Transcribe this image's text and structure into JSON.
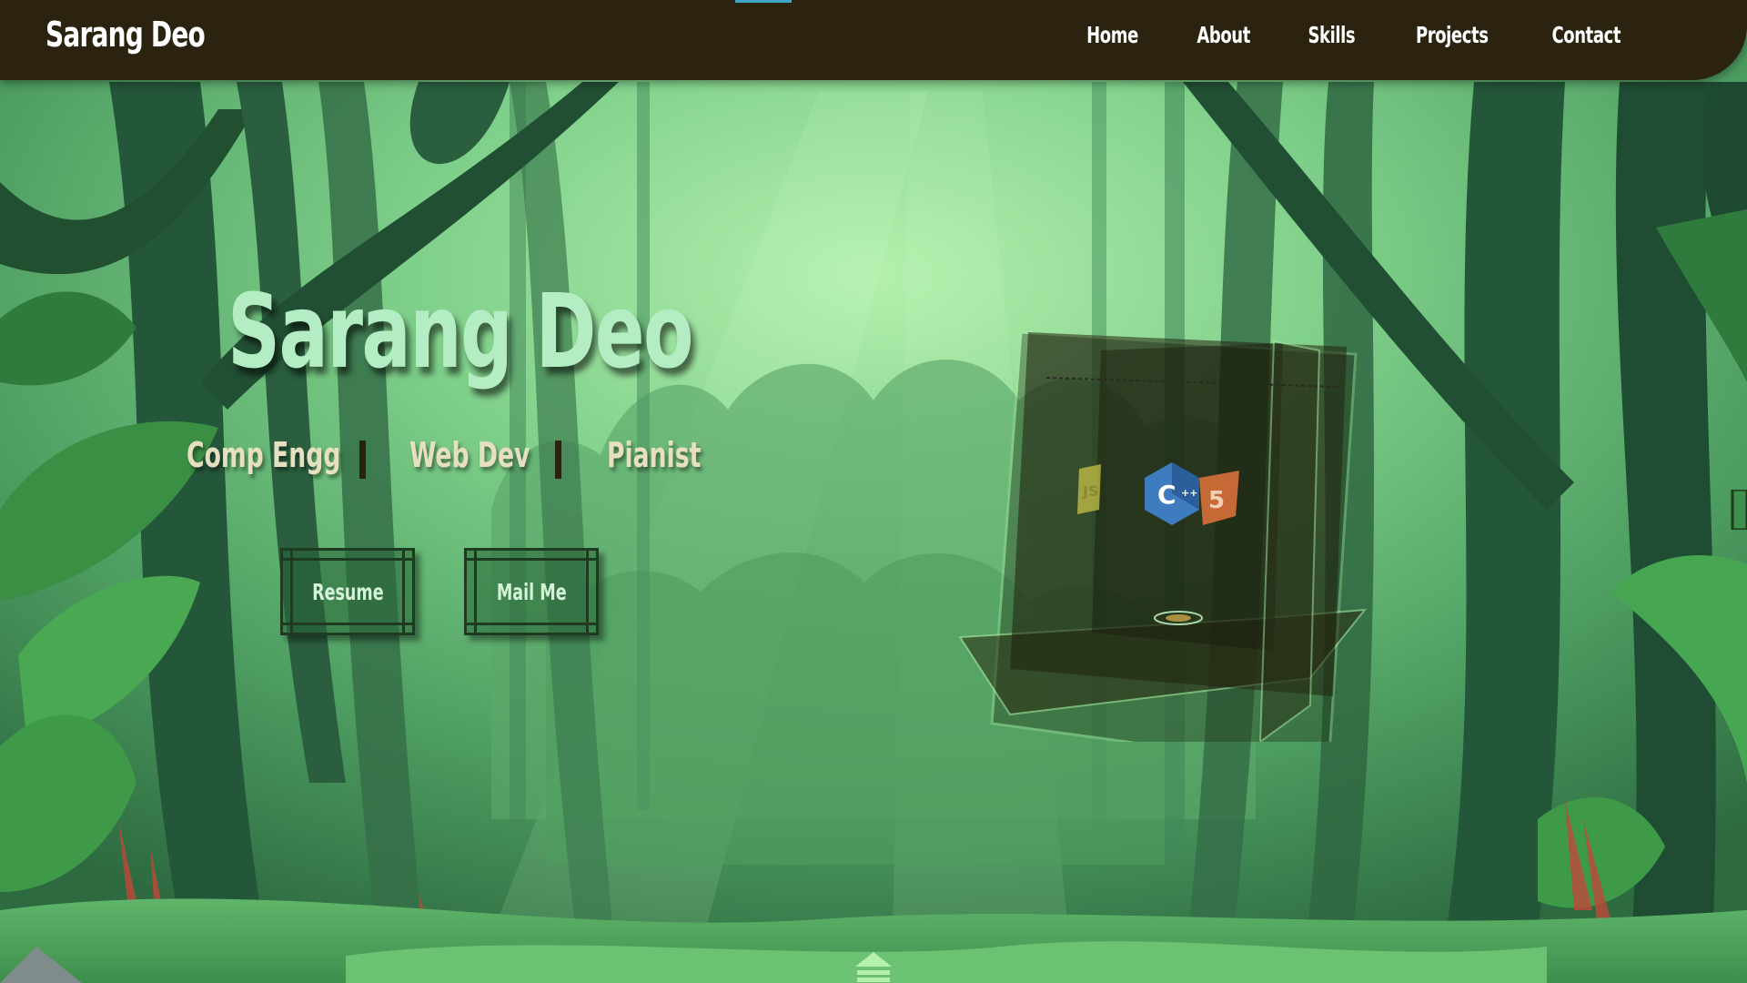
{
  "nav": {
    "brand": "Sarang Deo",
    "links": [
      "Home",
      "About",
      "Skills",
      "Projects",
      "Contact"
    ]
  },
  "hero": {
    "title": "Sarang Deo",
    "roles": [
      "Comp Engg",
      "Web Dev",
      "Pianist"
    ],
    "buttons": {
      "resume": "Resume",
      "mail": "Mail Me"
    }
  },
  "icons": {
    "cube_logos": [
      "js-icon",
      "cpp-icon",
      "html5-icon"
    ],
    "scroll": "up-arrow-icon",
    "side": "side-tab-icon"
  },
  "colors": {
    "navbar": "#2b2310",
    "title": "#b4ecc4",
    "roles": "#e6e0c0",
    "button_text": "#d4f3d8",
    "accent": "#3fa6c8"
  }
}
